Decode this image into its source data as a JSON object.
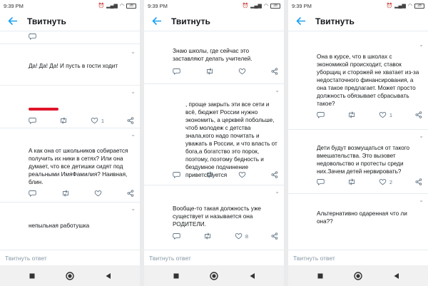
{
  "status": {
    "time": "9:39 PM",
    "battery": "28"
  },
  "header": {
    "title": "Твитнуть"
  },
  "reply": {
    "placeholder": "Твитнуть ответ"
  },
  "colors": {
    "accent": "#1da1f2",
    "text": "#14171a",
    "muted": "#657786",
    "redaction": "#e0152a"
  },
  "panels": [
    {
      "tweets": [
        {
          "text": "Да! Да! Да! И пусть в гости ходит",
          "reply": "",
          "retweet": "",
          "like": ""
        },
        {
          "text": "",
          "reply": "",
          "retweet": "",
          "like": "1"
        },
        {
          "text": "А как она от школьников собирается получить их ники в сетях? Или она думает, что все детишки сидят под реальными ИмяФамилия? Наивная, блин.",
          "reply": "",
          "retweet": "",
          "like": ""
        },
        {
          "text": "непыльная работушка",
          "reply": "",
          "retweet": "",
          "like": ""
        }
      ]
    },
    {
      "tweets": [
        {
          "text": "Знаю школы, где сейчас это заставляют делать учителей.",
          "reply": "",
          "retweet": "",
          "like": ""
        },
        {
          "text": ", проще закрыть эти все сети и всё, бюджет России нужно экономить, а церквей побольше, чтоб молодеж с детства знала,кого надо почитать и уважать в России, и что власть от бога,а богатство это порок, поэтому, поэтому бедность и бездумное подчинение приветствуется",
          "reply": "",
          "retweet": "",
          "like": ""
        },
        {
          "text": "Вообще-то такая должность уже существует и называется она РОДИТЕЛИ.",
          "reply": "",
          "retweet": "",
          "like": "8"
        }
      ]
    },
    {
      "tweets": [
        {
          "text": "Она в курсе, что в школах с экономикой происходит, ставок уборщиц и сторожей не хватает из-за недостаточного финансирования, а она такое предлагает. Может просто должность обязывает сбрасывать такое?",
          "reply": "",
          "retweet": "",
          "like": "1"
        },
        {
          "text": "Дети будут возмущаться от такого вмешательства. Это вызовет недовольство и протесты среди них.Зачем детей нервировать?",
          "reply": "",
          "retweet": "",
          "like": "2"
        },
        {
          "text": "Альтернативно одаренная что ли она??",
          "reply": "",
          "retweet": "",
          "like": "2"
        }
      ]
    }
  ]
}
